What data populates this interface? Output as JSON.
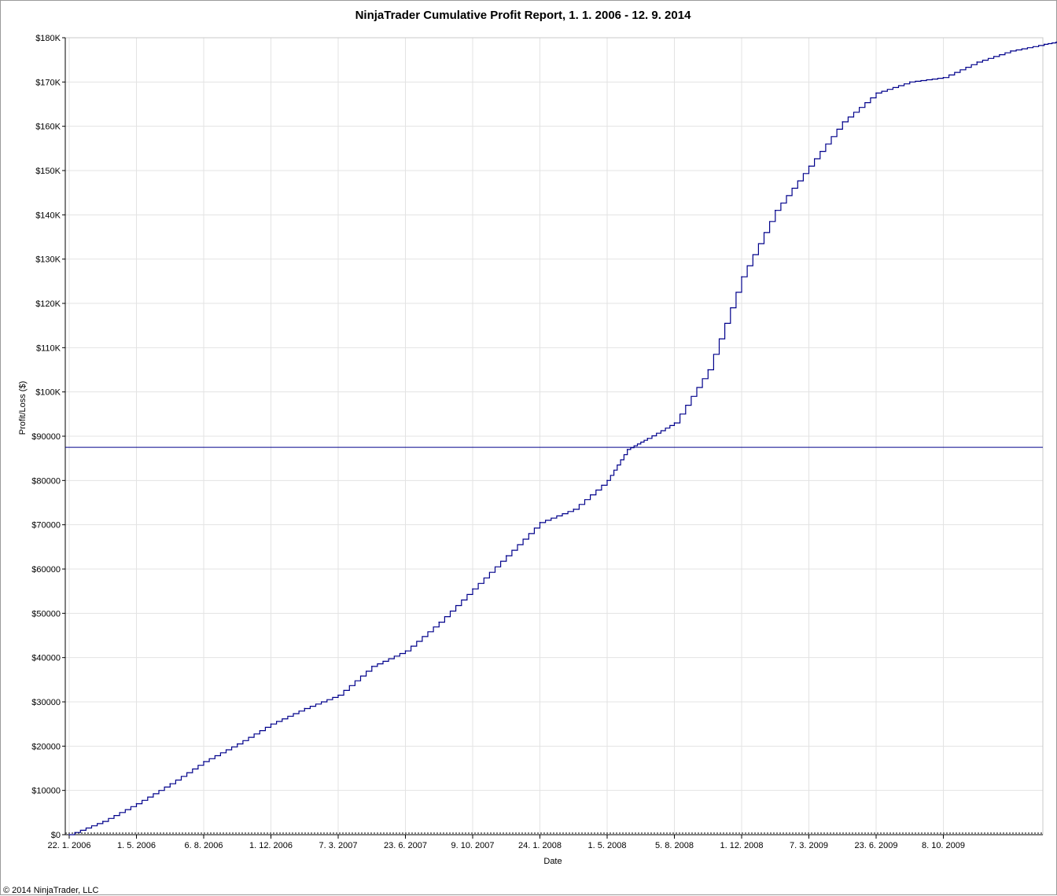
{
  "chart_data": {
    "type": "line",
    "title": "NinjaTrader Cumulative Profit Report, 1. 1. 2006 - 12. 9. 2014",
    "xlabel": "Date",
    "ylabel": "Profit/Loss ($)",
    "footer": "© 2014 NinjaTrader, LLC",
    "ylim": [
      0,
      180000
    ],
    "y_tick_values": [
      0,
      10000,
      20000,
      30000,
      40000,
      50000,
      60000,
      70000,
      80000,
      90000,
      100000,
      110000,
      120000,
      130000,
      140000,
      150000,
      160000,
      170000,
      180000
    ],
    "y_tick_labels": [
      "$0",
      "$10000",
      "$20000",
      "$30000",
      "$40000",
      "$50000",
      "$60000",
      "$70000",
      "$80000",
      "$90000",
      "$100K",
      "$110K",
      "$120K",
      "$130K",
      "$140K",
      "$150K",
      "$160K",
      "$170K",
      "$180K"
    ],
    "x_tick_labels": [
      "22. 1. 2006",
      "1. 5. 2006",
      "6. 8. 2006",
      "1. 12. 2006",
      "7. 3. 2007",
      "23. 6. 2007",
      "9. 10. 2007",
      "24. 1. 2008",
      "1. 5. 2008",
      "5. 8. 2008",
      "1. 12. 2008",
      "7. 3. 2009",
      "23. 6. 2009",
      "8. 10. 2009"
    ],
    "grid": true,
    "reference_line": {
      "value": 87500,
      "color": "#00008b"
    },
    "series": [
      {
        "color": "#00008b",
        "x_index": [
          0,
          0.5,
          1,
          1.5,
          2,
          2.5,
          3,
          3.5,
          4,
          4.5,
          5,
          5.5,
          6,
          6.5,
          7,
          7.5,
          8,
          8.3,
          8.6,
          9,
          9.5,
          10,
          10.5,
          11,
          11.5,
          12,
          12.5,
          13,
          13.5,
          14,
          14.5,
          14.85
        ],
        "values": [
          0,
          3000,
          7000,
          11500,
          16500,
          20500,
          25000,
          28500,
          31500,
          38000,
          41500,
          48000,
          55500,
          63000,
          70500,
          73500,
          80000,
          87000,
          89500,
          93000,
          105000,
          126000,
          141000,
          151000,
          161000,
          167500,
          170000,
          171000,
          174500,
          177000,
          178500,
          179500
        ]
      }
    ]
  }
}
